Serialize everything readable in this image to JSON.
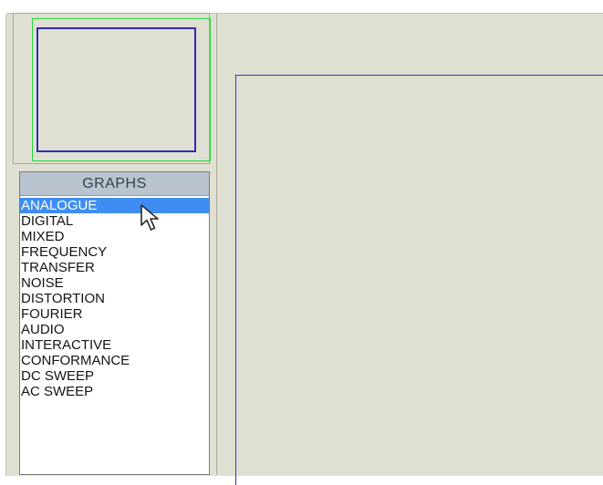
{
  "colors": {
    "background": "#e0e0d2",
    "selection": "#3f8df2",
    "header": "#b8c3cf",
    "sheet_border": "#3535d0",
    "overview_green": "#2ad43c"
  },
  "graph_selector": {
    "header": "GRAPHS",
    "selected_index": 0,
    "items": [
      "ANALOGUE",
      "DIGITAL",
      "MIXED",
      "FREQUENCY",
      "TRANSFER",
      "NOISE",
      "DISTORTION",
      "FOURIER",
      "AUDIO",
      "INTERACTIVE",
      "CONFORMANCE",
      "DC SWEEP",
      "AC SWEEP"
    ]
  },
  "cursor_icon": "mouse-pointer-icon"
}
